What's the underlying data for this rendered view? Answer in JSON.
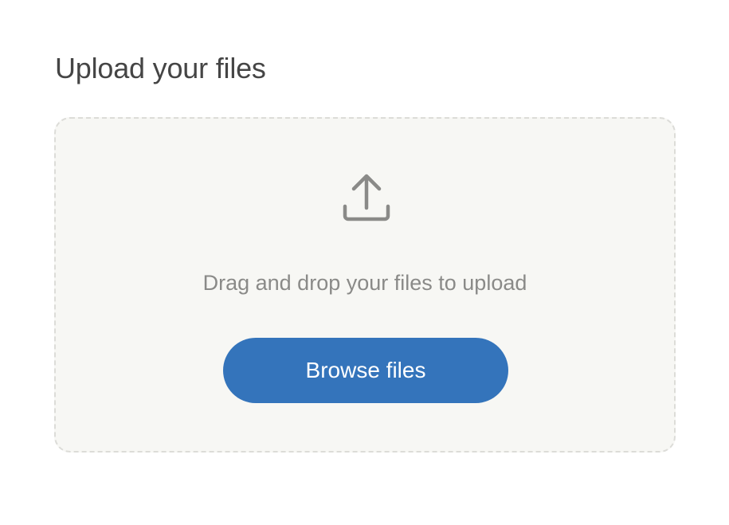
{
  "page": {
    "title": "Upload your files"
  },
  "dropzone": {
    "hint": "Drag and drop your files to upload",
    "icon": "upload-icon",
    "browse_label": "Browse files"
  },
  "colors": {
    "accent": "#3474bb",
    "dropzone_background": "#f7f7f4",
    "dropzone_border": "#dcdcd8",
    "title_text": "#454545",
    "hint_text": "#8a8a88"
  }
}
